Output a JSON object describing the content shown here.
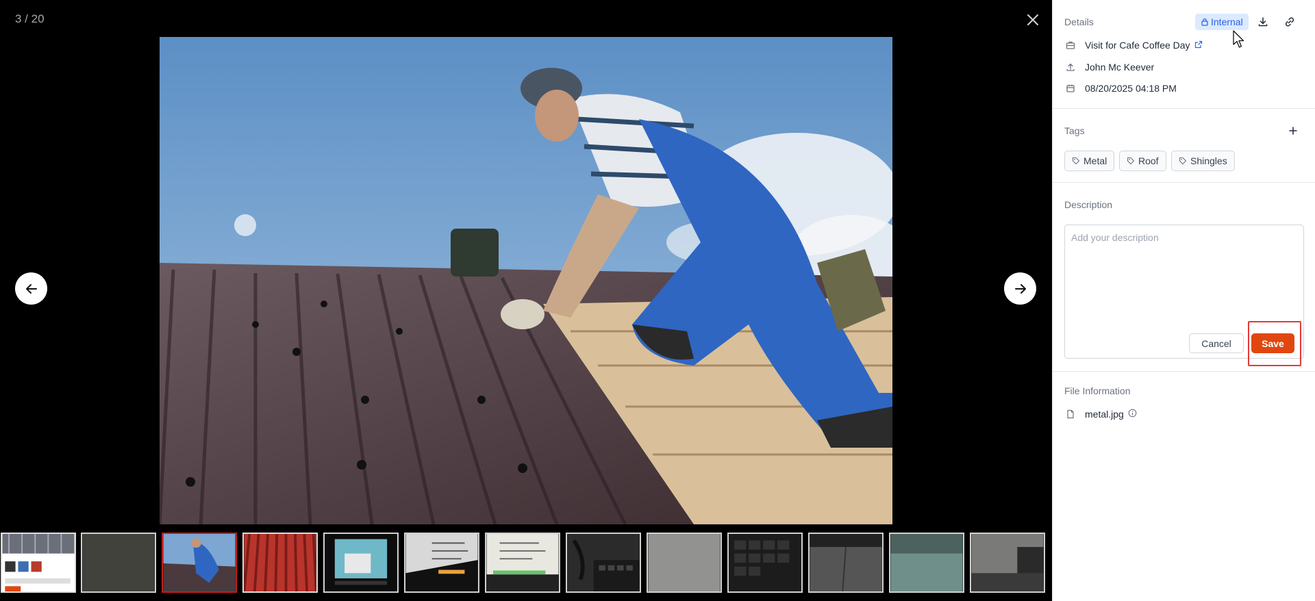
{
  "viewer": {
    "counter": "3 / 20",
    "main_image_alt": "",
    "thumbnail_count": 13,
    "selected_thumbnail": 3
  },
  "details": {
    "title": "Details",
    "visibility_badge": "Internal",
    "visit": "Visit for Cafe Coffee Day",
    "uploader": "John Mc Keever",
    "datetime": "08/20/2025 04:18 PM"
  },
  "tags": {
    "title": "Tags",
    "items": [
      "Metal",
      "Roof",
      "Shingles"
    ]
  },
  "description": {
    "title": "Description",
    "placeholder": "Add your description",
    "value": "",
    "cancel_label": "Cancel",
    "save_label": "Save"
  },
  "file_information": {
    "title": "File Information",
    "filename": "metal.jpg"
  },
  "colors": {
    "accent": "#e0470f",
    "badge_bg": "#dbeafe",
    "badge_text": "#2563eb",
    "selected_thumb_border": "#c41d1d",
    "highlight": "#e53935"
  }
}
